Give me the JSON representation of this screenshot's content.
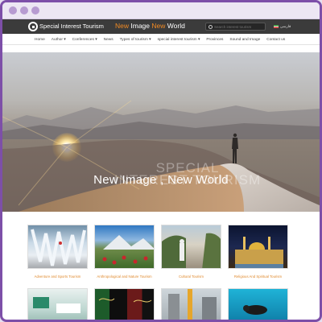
{
  "header": {
    "brand": "Special Interest Tourism",
    "slogan": {
      "w1": "New",
      "w2": "Image",
      "w3": "New",
      "w4": "World"
    },
    "search_placeholder": "Search interest tourism",
    "language": "فارسی"
  },
  "nav": {
    "items": [
      {
        "label": "Home"
      },
      {
        "label": "Author ▾"
      },
      {
        "label": "Conferences ▾"
      },
      {
        "label": "News"
      },
      {
        "label": "Types of tourism ▾"
      },
      {
        "label": "special interest tourism ▾"
      },
      {
        "label": "Provinces"
      },
      {
        "label": "Sound and Image"
      },
      {
        "label": "Contact us"
      }
    ]
  },
  "hero": {
    "subtitle_1": "SPECIAL",
    "subtitle_2": "INTEREST TOURISM",
    "title": "New Image , New World"
  },
  "categories": [
    {
      "label": "Adventure and Sports Tourism"
    },
    {
      "label": "Anthropological and Nature Tourism"
    },
    {
      "label": "Cultural Tourism"
    },
    {
      "label": "Religious And Spiritual Tourism"
    }
  ],
  "colors": {
    "accent": "#f08a24",
    "topbar": "#3b3b3b",
    "frame": "#7d4fa8"
  }
}
